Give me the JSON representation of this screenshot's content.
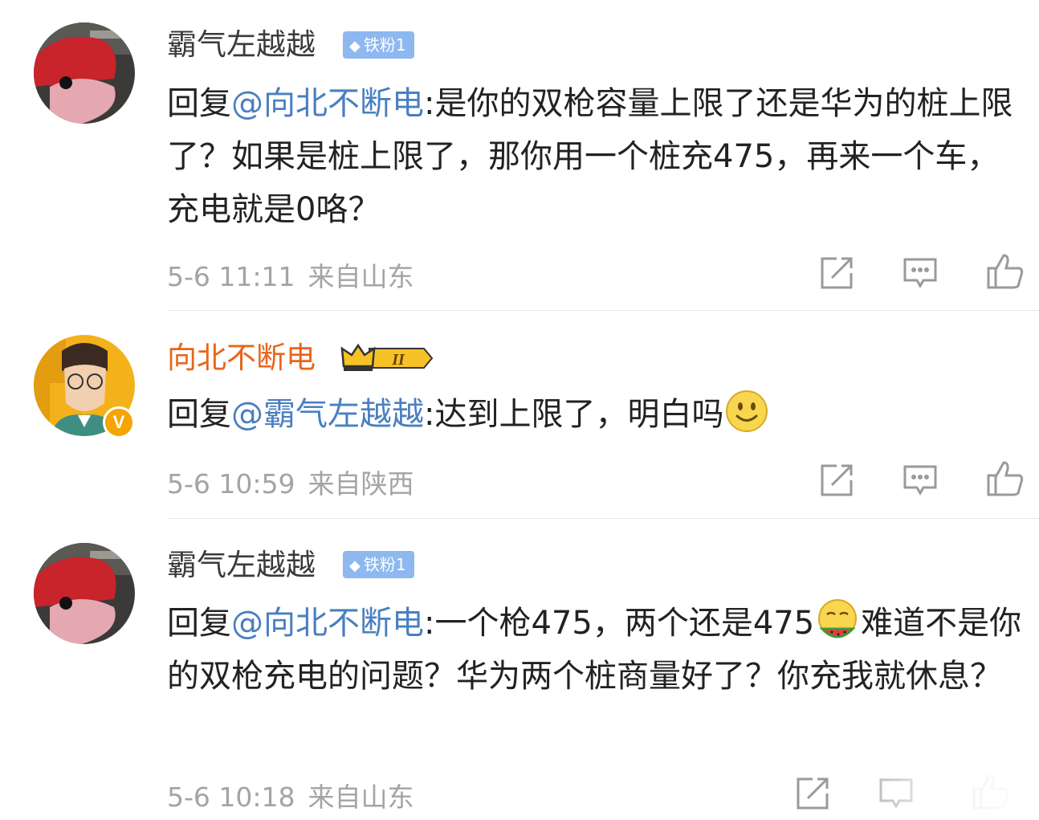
{
  "comments": [
    {
      "author": "霸气左越越",
      "badge": "铁粉1",
      "reply_prefix": "回复",
      "mention": "@向北不断电",
      "text": ":是你的双枪容量上限了还是华为的桩上限了？如果是桩上限了，那你用一个桩充475，再来一个车，充电就是0咯？",
      "time": "5-6 11:11",
      "source": "来自山东"
    },
    {
      "author": "向北不断电",
      "badge": "II",
      "verified": "V",
      "reply_prefix": "回复",
      "mention": "@霸气左越越",
      "text": ":达到上限了，明白吗",
      "emoji": "smile-emoji",
      "time": "5-6 10:59",
      "source": "来自陕西"
    },
    {
      "author": "霸气左越越",
      "badge": "铁粉1",
      "reply_prefix": "回复",
      "mention": "@向北不断电",
      "text_a": ":一个枪475，两个还是475",
      "emoji": "eating-watermelon-emoji",
      "text_b": "难道不是你的双枪充电的问题？华为两个桩商量好了？你充我就休息？",
      "time": "5-6 10:18",
      "source": "来自山东"
    }
  ],
  "actions": [
    "share-icon",
    "comment-icon",
    "like-icon"
  ],
  "colors": {
    "mention": "#4a7fc1",
    "vip_name": "#e8651a",
    "meta": "#a4a4a4",
    "fan_badge": "#8db8f0"
  }
}
